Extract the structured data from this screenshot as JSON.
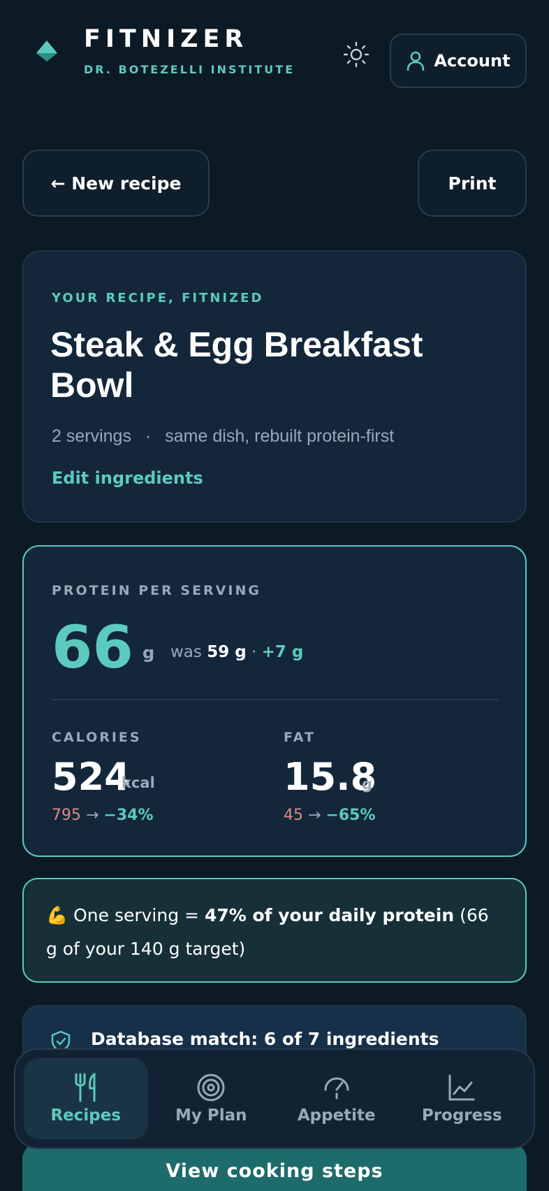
{
  "header": {
    "brand_title": "FITNIZER",
    "brand_subtitle": "DR. BOTEZELLI INSTITUTE",
    "account_label": "Account"
  },
  "actions": {
    "new_recipe_label": "← New recipe",
    "print_label": "Print"
  },
  "recipe": {
    "eyebrow": "YOUR RECIPE, FITNIZED",
    "title": "Steak & Egg Breakfast Bowl",
    "servings": "2 servings",
    "separator": "·",
    "description": "same dish, rebuilt protein-first",
    "edit_label": "Edit ingredients"
  },
  "nutrition": {
    "protein_label": "PROTEIN PER SERVING",
    "protein_value": "66",
    "protein_unit": "g",
    "protein_was_prefix": "was",
    "protein_was_value": "59 g",
    "protein_dot": "·",
    "protein_delta": "+7 g",
    "calories_label": "CALORIES",
    "calories_value": "524",
    "calories_unit": "kcal",
    "calories_old": "795",
    "calories_arrow": "→",
    "calories_change": "−34%",
    "fat_label": "FAT",
    "fat_value": "15.8",
    "fat_unit": "g",
    "fat_old": "45",
    "fat_arrow": "→",
    "fat_change": "−65%"
  },
  "callout": {
    "emoji": "💪",
    "prefix": "One serving = ",
    "highlight": "47% of your daily protein",
    "suffix": " (66 g of your 140 g target)"
  },
  "database": {
    "text": "Database match: 6 of 7 ingredients"
  },
  "nav": {
    "items": [
      {
        "label": "Recipes",
        "icon": "utensils-icon",
        "active": true
      },
      {
        "label": "My Plan",
        "icon": "target-icon",
        "active": false
      },
      {
        "label": "Appetite",
        "icon": "gauge-icon",
        "active": false
      },
      {
        "label": "Progress",
        "icon": "chart-line-icon",
        "active": false
      }
    ]
  },
  "cta": {
    "label": "View cooking steps"
  },
  "colors": {
    "background": "#0c1a26",
    "accent": "#5ccbbd",
    "card": "#14273a",
    "negative_old": "#d68c84"
  }
}
